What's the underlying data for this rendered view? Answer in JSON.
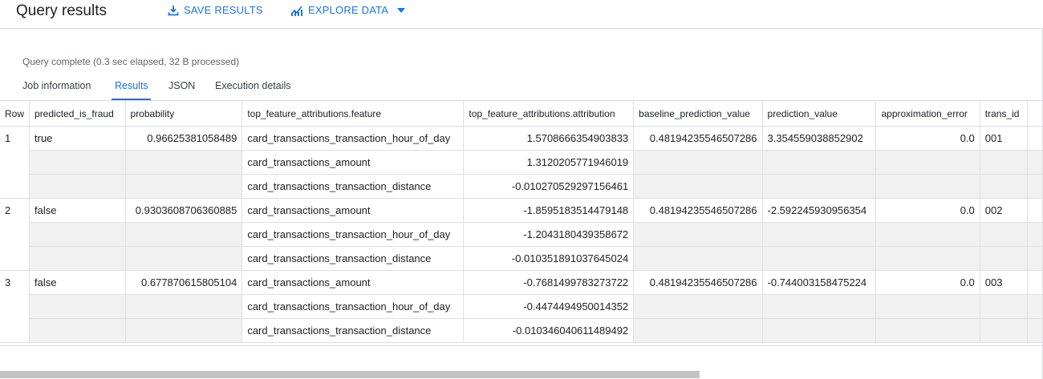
{
  "header": {
    "title": "Query results",
    "save_label": "SAVE RESULTS",
    "explore_label": "EXPLORE DATA"
  },
  "status": "Query complete (0.3 sec elapsed, 32 B processed)",
  "tabs": [
    {
      "label": "Job information"
    },
    {
      "label": "Results"
    },
    {
      "label": "JSON"
    },
    {
      "label": "Execution details"
    }
  ],
  "table": {
    "columns": [
      "Row",
      "predicted_is_fraud",
      "probability",
      "top_feature_attributions.feature",
      "top_feature_attributions.attribution",
      "baseline_prediction_value",
      "prediction_value",
      "approximation_error",
      "trans_id"
    ],
    "rows": [
      {
        "row": "1",
        "predicted_is_fraud": "true",
        "probability": "0.96625381058489",
        "attributions": [
          {
            "feature": "card_transactions_transaction_hour_of_day",
            "attribution": "1.5708666354903833"
          },
          {
            "feature": "card_transactions_amount",
            "attribution": "1.3120205771946019"
          },
          {
            "feature": "card_transactions_transaction_distance",
            "attribution": "-0.010270529297156461"
          }
        ],
        "baseline_prediction_value": "0.48194235546507286",
        "prediction_value": "3.354559038852902",
        "approximation_error": "0.0",
        "trans_id": "001"
      },
      {
        "row": "2",
        "predicted_is_fraud": "false",
        "probability": "0.9303608706360885",
        "attributions": [
          {
            "feature": "card_transactions_amount",
            "attribution": "-1.8595183514479148"
          },
          {
            "feature": "card_transactions_transaction_hour_of_day",
            "attribution": "-1.2043180439358672"
          },
          {
            "feature": "card_transactions_transaction_distance",
            "attribution": "-0.010351891037645024"
          }
        ],
        "baseline_prediction_value": "0.48194235546507286",
        "prediction_value": "-2.592245930956354",
        "approximation_error": "0.0",
        "trans_id": "002"
      },
      {
        "row": "3",
        "predicted_is_fraud": "false",
        "probability": "0.677870615805104",
        "attributions": [
          {
            "feature": "card_transactions_amount",
            "attribution": "-0.7681499783273722"
          },
          {
            "feature": "card_transactions_transaction_hour_of_day",
            "attribution": "-0.4474494950014352"
          },
          {
            "feature": "card_transactions_transaction_distance",
            "attribution": "-0.010346040611489492"
          }
        ],
        "baseline_prediction_value": "0.48194235546507286",
        "prediction_value": "-0.744003158475224",
        "approximation_error": "0.0",
        "trans_id": "003"
      }
    ]
  },
  "colors": {
    "accent": "#1a73e8",
    "grey_cell": "#f1f1f1"
  },
  "icons": {
    "save": "download-icon",
    "explore": "chart-icon",
    "dropdown": "caret-down-icon"
  }
}
